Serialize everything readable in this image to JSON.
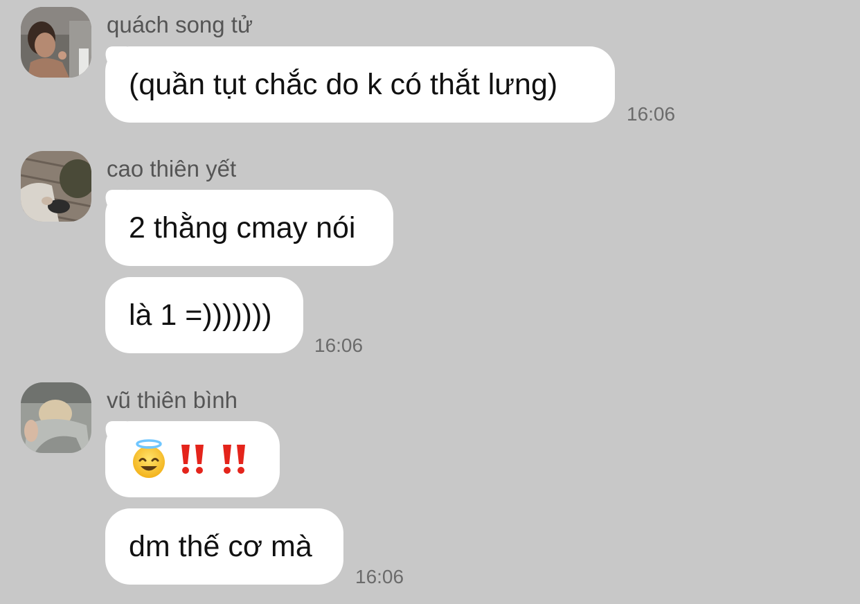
{
  "chat": {
    "messages": [
      {
        "sender": "quách song tử",
        "avatar": "avatar-photo-person-mirror",
        "bubbles": [
          "(quần tụt chắc do k có thắt lưng)"
        ],
        "time": "16:06"
      },
      {
        "sender": "cao thiên yết",
        "avatar": "avatar-photo-person-hat-floor",
        "bubbles": [
          "2 thằng cmay nói",
          "là 1 =)))))))"
        ],
        "time": "16:06"
      },
      {
        "sender": "vũ thiên bình",
        "avatar": "avatar-photo-person-blanket",
        "bubbles": [
          "😇‼️‼️",
          "dm thế cơ mà"
        ],
        "emoji_icons": [
          "smiling-face-with-halo-icon",
          "double-exclamation-icon",
          "double-exclamation-icon"
        ],
        "time": "16:06"
      }
    ]
  },
  "colors": {
    "background": "#c8c8c8",
    "bubble": "#ffffff",
    "sender_text": "#555555",
    "time_text": "#6b6b6b",
    "message_text": "#111111"
  }
}
